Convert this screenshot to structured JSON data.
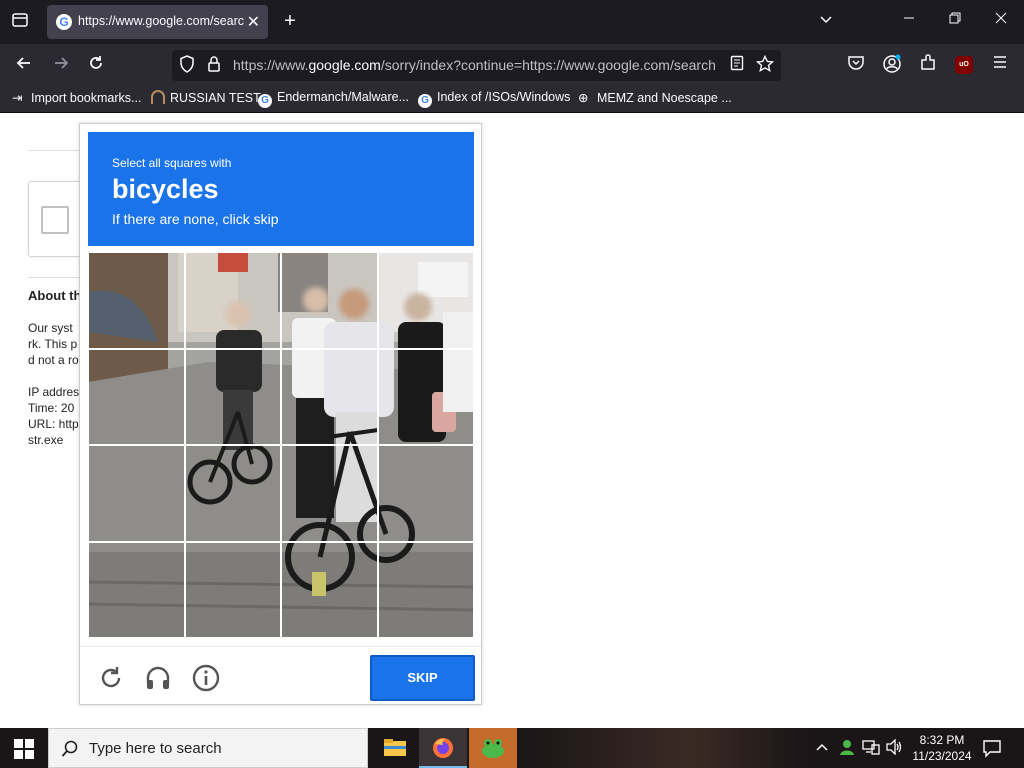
{
  "browser": {
    "tab_title": "https://www.google.com/search",
    "url_prefix": "https://www.",
    "url_domain": "google.com",
    "url_rest": "/sorry/index?continue=https://www.google.com/search",
    "bookmarks": [
      {
        "label": "Import bookmarks...",
        "icon": "import-icon"
      },
      {
        "label": "RUSSIAN TEST",
        "icon": "horseshoe-icon"
      },
      {
        "label": "Endermanch/Malware...",
        "icon": "google-icon"
      },
      {
        "label": "Index of /ISOs/Windows",
        "icon": "google-icon"
      },
      {
        "label": "MEMZ and Noescape ...",
        "icon": "globe-icon"
      }
    ],
    "extension_badge": "uO"
  },
  "page": {
    "about_heading": "About th",
    "body_lines": [
      "Our syst",
      "rk. This p",
      "d not a ro"
    ],
    "info_lines": [
      "IP addres",
      "Time: 20",
      "URL: http",
      "str.exe"
    ]
  },
  "captcha": {
    "instruction": "Select all squares with",
    "target": "bicycles",
    "hint": "If there are none, click skip",
    "skip_label": "SKIP",
    "colors": {
      "header": "#1a73e8"
    }
  },
  "taskbar": {
    "search_placeholder": "Type here to search",
    "time": "8:32 PM",
    "date": "11/23/2024"
  }
}
